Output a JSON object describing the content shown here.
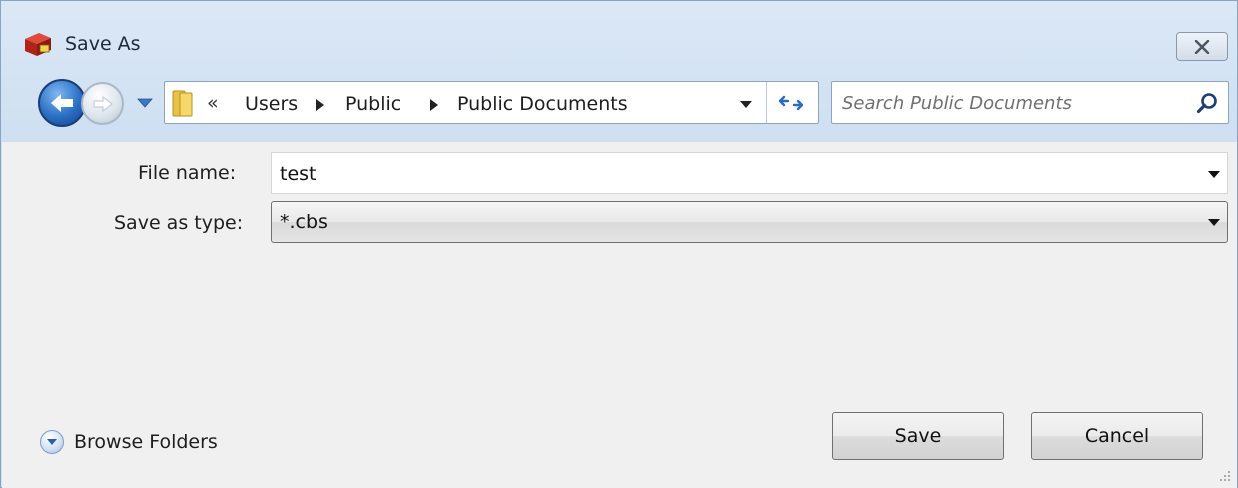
{
  "window": {
    "title": "Save As",
    "app_icon": "app-icon",
    "close_icon": "close-icon"
  },
  "nav": {
    "back_icon": "back-arrow-icon",
    "forward_icon": "forward-arrow-icon",
    "recent_icon": "recent-pages-dropdown-icon"
  },
  "address": {
    "overflow": "«",
    "crumbs": [
      "Users",
      "Public",
      "Public Documents"
    ],
    "folder_icon": "folder-icon",
    "refresh_icon": "refresh-icon"
  },
  "search": {
    "placeholder": "Search Public Documents",
    "icon": "search-icon"
  },
  "form": {
    "file_name_label": "File name:",
    "file_name_value": "test",
    "save_type_label": "Save as type:",
    "save_type_value": "*.cbs"
  },
  "footer": {
    "browse_folders": "Browse Folders",
    "save": "Save",
    "cancel": "Cancel"
  }
}
